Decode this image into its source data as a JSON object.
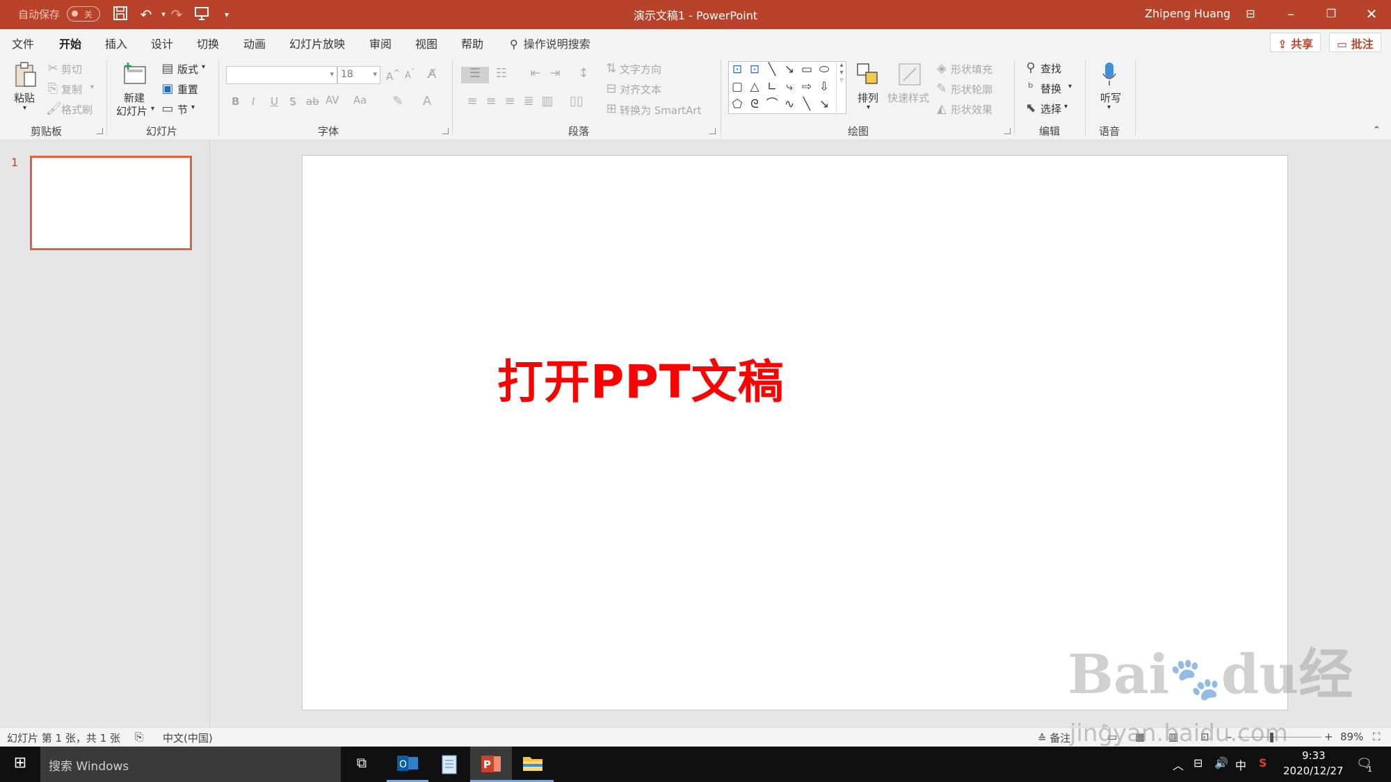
{
  "titlebar": {
    "autosave_label": "自动保存",
    "autosave_state": "关",
    "document_title": "演示文稿1  -  PowerPoint",
    "user_name": "Zhipeng Huang",
    "bar_color": "#b8432a"
  },
  "menu": {
    "tabs": [
      "文件",
      "开始",
      "插入",
      "设计",
      "切换",
      "动画",
      "幻灯片放映",
      "审阅",
      "视图",
      "帮助"
    ],
    "active_tab": "开始",
    "tell_me": "操作说明搜索",
    "share": "共享",
    "comments": "批注"
  },
  "ribbon": {
    "clipboard": {
      "paste": "粘贴",
      "cut": "剪切",
      "copy": "复制",
      "format_painter": "格式刷",
      "label": "剪贴板"
    },
    "slides": {
      "new_slide_line1": "新建",
      "new_slide_line2": "幻灯片",
      "layout": "版式",
      "reset": "重置",
      "section": "节",
      "label": "幻灯片"
    },
    "font": {
      "font_name": "",
      "font_size": "18",
      "bold": "B",
      "italic": "I",
      "underline": "U",
      "shadow": "S",
      "strike": "ab",
      "spacing": "AV",
      "case": "Aa",
      "label": "字体"
    },
    "paragraph": {
      "text_direction": "文字方向",
      "align_text": "对齐文本",
      "smartart": "转换为 SmartArt",
      "label": "段落"
    },
    "drawing": {
      "arrange": "排列",
      "quick_styles": "快速样式",
      "shape_fill": "形状填充",
      "shape_outline": "形状轮廓",
      "shape_effects": "形状效果",
      "label": "绘图"
    },
    "editing": {
      "find": "查找",
      "replace": "替换",
      "select": "选择",
      "label": "编辑"
    },
    "voice": {
      "dictate": "听写",
      "label": "语音"
    }
  },
  "thumbnails": {
    "slide_number": "1"
  },
  "slide": {
    "text": "打开PPT文稿",
    "text_color": "#ff0000"
  },
  "watermark": {
    "brand": "Bai",
    "brand_suffix": "du",
    "product": "经验",
    "url": "jingyan.baidu.com"
  },
  "statusbar": {
    "slide_info": "幻灯片 第 1 张，共 1 张",
    "language": "中文(中国)",
    "notes": "备注",
    "zoom": "89%"
  },
  "taskbar": {
    "search_placeholder": "搜索 Windows",
    "ime": "中",
    "time": "9:33",
    "date": "2020/12/27",
    "notification_count": "1"
  }
}
